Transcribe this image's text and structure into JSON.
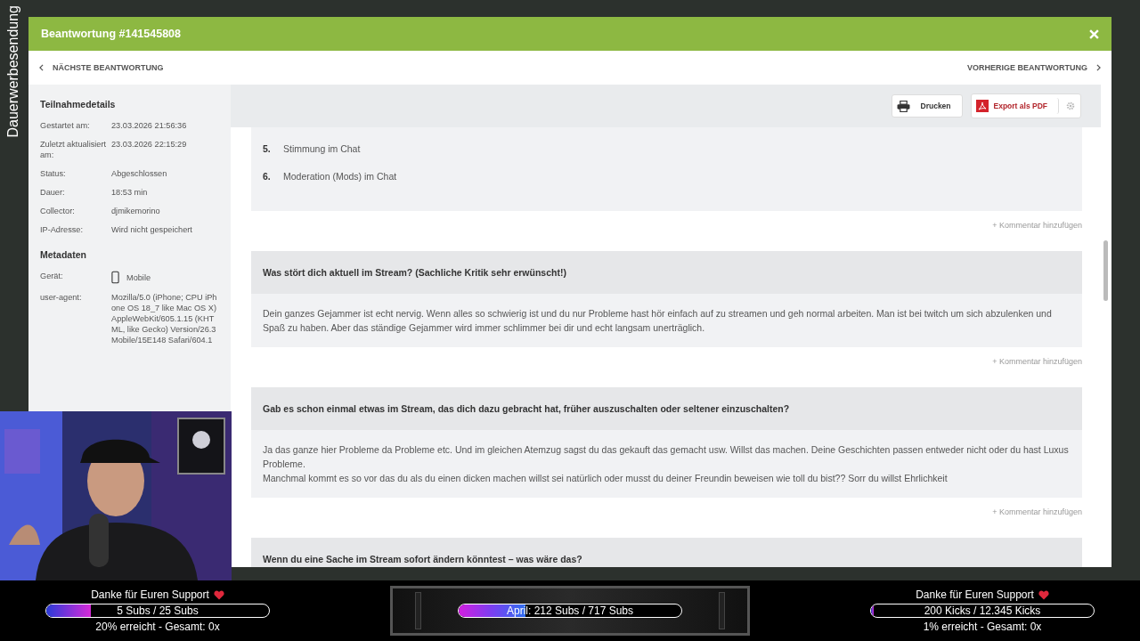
{
  "overlay_label": "Dauerwerbesendung",
  "modal": {
    "title": "Beantwortung #141545808",
    "next_label": "NÄCHSTE BEANTWORTUNG",
    "prev_label": "VORHERIGE BEANTWORTUNG"
  },
  "sidebar": {
    "sections": [
      {
        "heading": "Teilnahmedetails",
        "rows": [
          {
            "kind": "text",
            "label": "Gestartet am:",
            "value": "23.03.2026 21:56:36"
          },
          {
            "kind": "text",
            "label": "Zuletzt aktualisiert am:",
            "value": "23.03.2026 22:15:29"
          },
          {
            "kind": "text",
            "label": "Status:",
            "value": "Abgeschlossen"
          },
          {
            "kind": "text",
            "label": "Dauer:",
            "value": "18:53 min"
          },
          {
            "kind": "text",
            "label": "Collector:",
            "value": "djmikemorino"
          },
          {
            "kind": "text",
            "label": "IP-Adresse:",
            "value": "Wird nicht gespeichert"
          }
        ]
      },
      {
        "heading": "Metadaten",
        "rows": [
          {
            "kind": "device",
            "label": "Gerät:",
            "value": "Mobile"
          },
          {
            "kind": "text",
            "label": "user-agent:",
            "value": "Mozilla/5.0 (iPhone; CPU iPhone OS 18_7 like Mac OS X) AppleWebKit/605.1.15 (KHTML, like Gecko) Version/26.3 Mobile/15E148 Safari/604.1"
          }
        ]
      }
    ]
  },
  "toolbar": {
    "print": "Drucken",
    "export": "Export als PDF"
  },
  "answers": [
    {
      "kind": "list",
      "items": [
        {
          "number": "5.",
          "text": "Stimmung im Chat"
        },
        {
          "number": "6.",
          "text": "Moderation (Mods) im Chat"
        }
      ],
      "comment_link": "+ Kommentar hinzufügen"
    },
    {
      "kind": "text",
      "question": "Was stört dich aktuell im Stream? (Sachliche Kritik sehr erwünscht!)",
      "paragraphs": [
        "Dein ganzes Gejammer ist echt nervig. Wenn alles so schwierig ist und du nur Probleme hast hör einfach auf zu streamen und geh normal arbeiten. Man ist bei twitch um sich abzulenken und Spaß zu haben. Aber das ständige Gejammer wird immer schlimmer bei dir und echt langsam unerträglich."
      ],
      "comment_link": "+ Kommentar hinzufügen"
    },
    {
      "kind": "text",
      "question": "Gab es schon einmal etwas im Stream, das dich dazu gebracht hat, früher auszuschalten oder seltener einzuschalten?",
      "paragraphs": [
        "Ja das ganze hier Probleme da Probleme etc. Und im gleichen Atemzug sagst du das gekauft das gemacht usw. Willst das machen. Deine Geschichten passen entweder nicht oder du hast Luxus Probleme.",
        "Manchmal kommt es so vor das du als du einen dicken machen willst sei natürlich oder musst du deiner Freundin beweisen wie toll du bist?? Sorr du willst Ehrlichkeit"
      ],
      "comment_link": "+ Kommentar hinzufügen"
    },
    {
      "kind": "text",
      "question": "Wenn du eine Sache im Stream sofort ändern könntest – was wäre das?"
    }
  ],
  "support_bar": {
    "widgets": [
      {
        "kind": "goal",
        "title": "Danke für Euren Support",
        "progress_text": "5 Subs / 25 Subs",
        "level": 0.2,
        "summary": "20% erreicht - Gesamt: 0x"
      },
      {
        "kind": "month",
        "progress_text": "April: 212 Subs / 717 Subs",
        "level": 0.3
      },
      {
        "kind": "goal",
        "title": "Danke für Euren Support",
        "progress_text": "200 Kicks / 12.345 Kicks",
        "level": 0.01,
        "summary": "1% erreicht - Gesamt: 0x"
      }
    ]
  }
}
